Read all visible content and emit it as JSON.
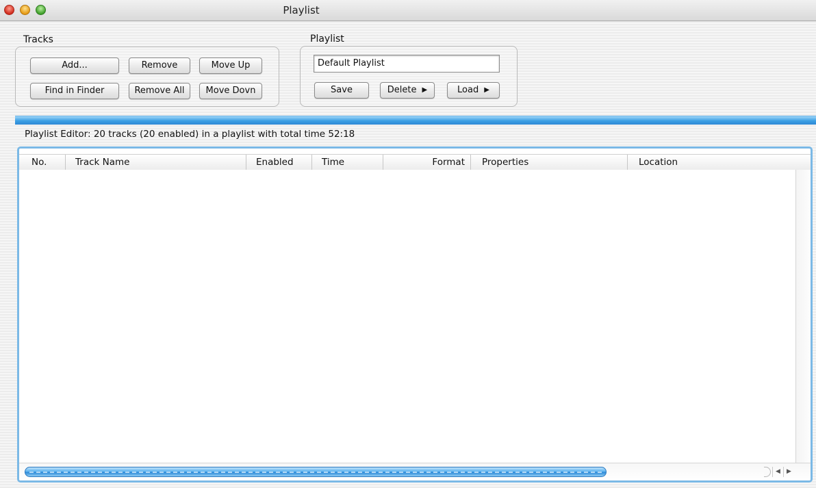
{
  "window": {
    "title": "Playlist"
  },
  "tracks_group": {
    "label": "Tracks",
    "buttons": {
      "add": "Add...",
      "remove": "Remove",
      "move_up": "Move Up",
      "find_in_finder": "Find in Finder",
      "remove_all": "Remove All",
      "move_down": "Move Dovn"
    }
  },
  "playlist_group": {
    "label": "Playlist",
    "name_value": "Default Playlist",
    "buttons": {
      "save": "Save",
      "delete": "Delete",
      "load": "Load"
    },
    "menu_arrow": "▶"
  },
  "status": "Playlist Editor: 20 tracks (20 enabled) in a playlist with total time 52:18",
  "table": {
    "columns": [
      "No.",
      "Track Name",
      "Enabled",
      "Time",
      "Format",
      "Properties",
      "Location"
    ],
    "rows": []
  },
  "scrollbar": {
    "left_arrow": "◀",
    "right_arrow": "▶"
  },
  "colors": {
    "accent_blue": "#3b9fe4",
    "frame_blue": "#7bb9e6"
  },
  "icons": [
    "close-traffic-light-icon",
    "minimize-traffic-light-icon",
    "zoom-traffic-light-icon",
    "menu-arrow-icon"
  ]
}
